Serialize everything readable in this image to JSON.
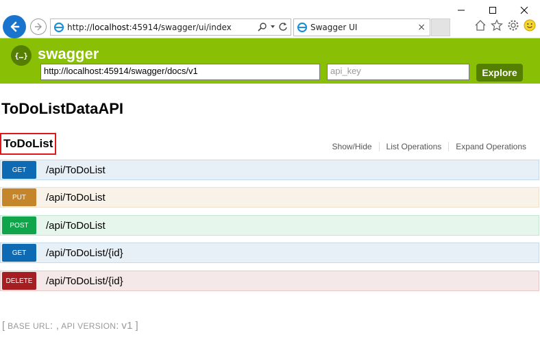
{
  "browser": {
    "address_url_prefix": "http://",
    "address_url_host": "localhost",
    "address_url_rest": ":45914/swagger/ui/index",
    "tab_title": "Swagger UI",
    "tab_close": "×"
  },
  "swagger_header": {
    "logo_text": "{…}",
    "brand": "swagger",
    "spec_url": "http://localhost:45914/swagger/docs/v1",
    "api_key_placeholder": "api_key",
    "explore_label": "Explore",
    "header_color": "#89bf04",
    "explore_color": "#547f00"
  },
  "api_title": "ToDoListDataAPI",
  "resource": {
    "name": "ToDoList",
    "links": [
      "Show/Hide",
      "List Operations",
      "Expand Operations"
    ]
  },
  "operations": [
    {
      "method": "GET",
      "path": "/api/ToDoList",
      "color": "#0f6ab4"
    },
    {
      "method": "PUT",
      "path": "/api/ToDoList",
      "color": "#c5862b"
    },
    {
      "method": "POST",
      "path": "/api/ToDoList",
      "color": "#10a54a"
    },
    {
      "method": "GET",
      "path": "/api/ToDoList/{id}",
      "color": "#0f6ab4"
    },
    {
      "method": "DELETE",
      "path": "/api/ToDoList/{id}",
      "color": "#a41e22"
    }
  ],
  "footer": {
    "open": "[",
    "base_url_label": "BASE URL",
    "sep1": ": ,",
    "api_version_label": "API VERSION",
    "sep2": ":",
    "version": "v1",
    "close": "]"
  }
}
